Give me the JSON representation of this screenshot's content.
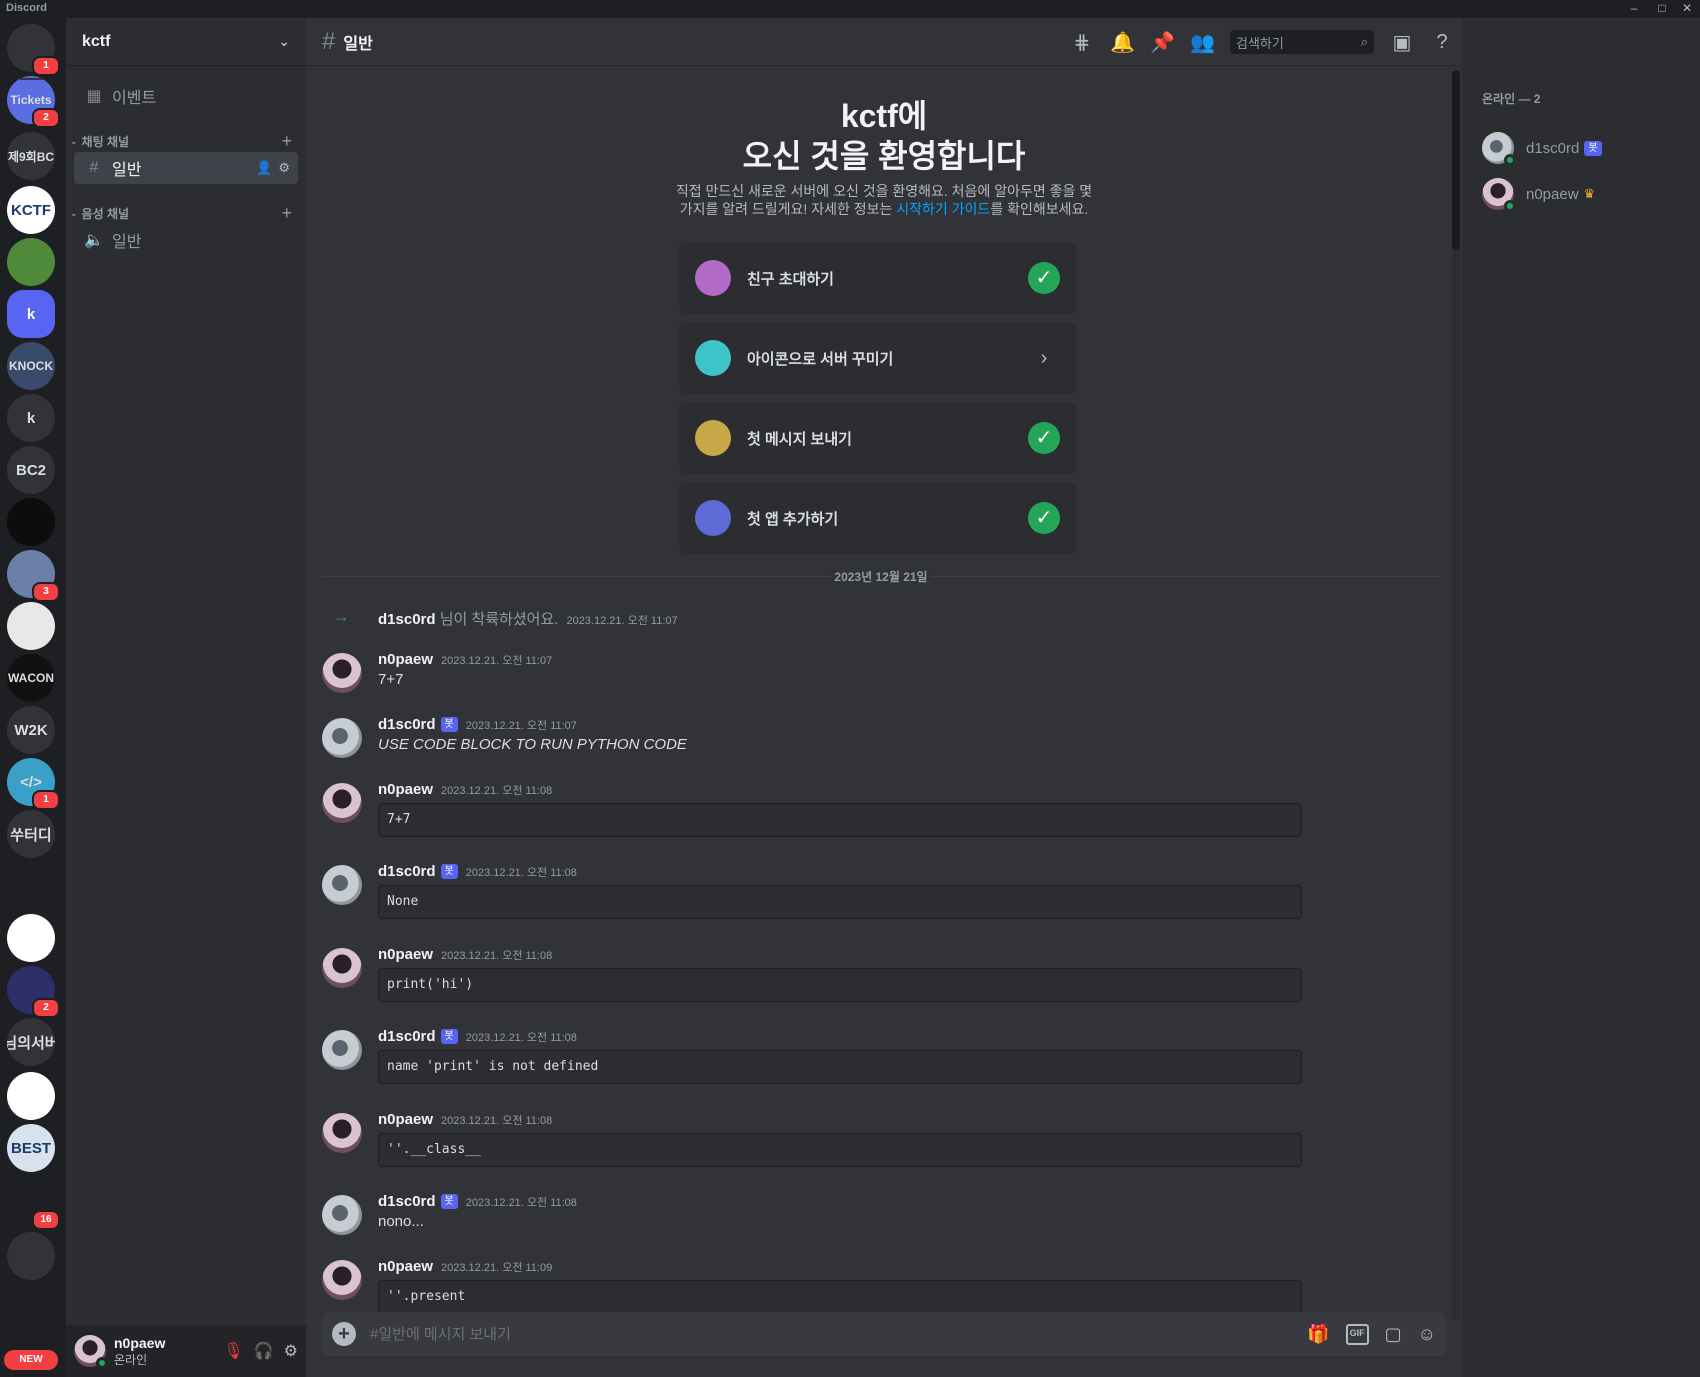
{
  "window": {
    "title": "Discord",
    "controls": [
      "–",
      "□",
      "✕"
    ]
  },
  "rail": {
    "servers": [
      {
        "label": "",
        "icon": "discord-home-icon",
        "badge": "1",
        "bg": "#313338"
      },
      {
        "label": "Tickets",
        "badge": "2",
        "bg": "#5b6ee1"
      },
      {
        "label": "제9회BC",
        "badge": "",
        "bg": "#313338"
      },
      {
        "label": "KCTF",
        "badge": "",
        "bg": "#ffffff"
      },
      {
        "label": "",
        "icon": "pepe-icon",
        "badge": "",
        "bg": "#4f8a3b"
      },
      {
        "label": "k",
        "badge": "",
        "bg": "#5865f2",
        "active": true
      },
      {
        "label": "KNOCK",
        "badge": "",
        "bg": "#3a4a6b"
      },
      {
        "label": "k",
        "badge": "",
        "bg": "#313338"
      },
      {
        "label": "BC2",
        "badge": "",
        "bg": "#313338"
      },
      {
        "label": "",
        "icon": "sword-icon",
        "badge": "",
        "bg": "#0d0d0d"
      },
      {
        "label": "",
        "icon": "emblem-icon",
        "badge": "3",
        "bg": "#6b7fa8"
      },
      {
        "label": "",
        "icon": "star-emblem-icon",
        "badge": "",
        "bg": "#e8e8e8"
      },
      {
        "label": "WACON",
        "badge": "",
        "bg": "#111111"
      },
      {
        "label": "W2K",
        "badge": "",
        "bg": "#313338"
      },
      {
        "label": "</>",
        "badge": "1",
        "bg": "#3aa0c8"
      },
      {
        "label": "쑤터디",
        "badge": "",
        "bg": "#313338"
      },
      {
        "label": "",
        "icon": "arrow-logo-icon",
        "badge": "",
        "bg": "#1e1f22"
      },
      {
        "label": "",
        "icon": "sunglasses-icon",
        "badge": "",
        "bg": "#ffffff"
      },
      {
        "label": "",
        "icon": "book-icon",
        "badge": "2",
        "bg": "#2d2f6b"
      },
      {
        "label": "님의서버",
        "badge": "",
        "bg": "#313338"
      },
      {
        "label": "",
        "icon": "rune-icon",
        "badge": "",
        "bg": "#ffffff"
      },
      {
        "label": "BEST",
        "badge": "",
        "bg": "#d7e2ee"
      },
      {
        "label": "",
        "icon": "blocks-icon",
        "badge": "16",
        "bg": "#1e1f22"
      },
      {
        "label": "",
        "icon": "folder-icon",
        "badge": "",
        "bg": "#313338"
      }
    ],
    "new_label": "NEW"
  },
  "sidebar": {
    "server_name": "kctf",
    "events_label": "이벤트",
    "text_category": "채팅 채널",
    "text_channel": "일반",
    "voice_category": "음성 채널",
    "voice_channel": "일반",
    "user": {
      "name": "n0paew",
      "status": "온라인"
    }
  },
  "header": {
    "channel": "일반",
    "search_placeholder": "검색하기"
  },
  "welcome": {
    "title_line1": "kctf에",
    "title_line2": "오신 것을 환영합니다",
    "desc_before": "직접 만드신 새로운 서버에 오신 것을 환영해요. 처음에 알아두면 좋을 몇 가지를 알려 드릴게요! 자세한 정보는 ",
    "desc_link": "시작하기 가이드",
    "desc_after": "를 확인해보세요."
  },
  "cards": [
    {
      "label": "친구 초대하기",
      "done": true,
      "icon_color": "#b26ac7"
    },
    {
      "label": "아이콘으로 서버 꾸미기",
      "done": false,
      "icon_color": "#3ec3c9"
    },
    {
      "label": "첫 메시지 보내기",
      "done": true,
      "icon_color": "#c9a84a"
    },
    {
      "label": "첫 앱 추가하기",
      "done": true,
      "icon_color": "#5c6bd6"
    }
  ],
  "date_divider": "2023년 12월 21일",
  "join": {
    "name": "d1sc0rd",
    "text": " 님이 착륙하셨어요.",
    "time": "2023.12.21. 오전 11:07"
  },
  "messages": [
    {
      "user": "n0paew",
      "bot": false,
      "time": "2023.12.21. 오전 11:07",
      "text": "7+7",
      "code": false
    },
    {
      "user": "d1sc0rd",
      "bot": true,
      "time": "2023.12.21. 오전 11:07",
      "text": "USE CODE BLOCK TO RUN PYTHON CODE",
      "code": false,
      "italic": true
    },
    {
      "user": "n0paew",
      "bot": false,
      "time": "2023.12.21. 오전 11:08",
      "text": "7+7",
      "code": true
    },
    {
      "user": "d1sc0rd",
      "bot": true,
      "time": "2023.12.21. 오전 11:08",
      "text": "None",
      "code": true
    },
    {
      "user": "n0paew",
      "bot": false,
      "time": "2023.12.21. 오전 11:08",
      "text": "print('hi')",
      "code": true
    },
    {
      "user": "d1sc0rd",
      "bot": true,
      "time": "2023.12.21. 오전 11:08",
      "text": "name 'print' is not defined",
      "code": true
    },
    {
      "user": "n0paew",
      "bot": false,
      "time": "2023.12.21. 오전 11:08",
      "text": "''.__class__",
      "code": true
    },
    {
      "user": "d1sc0rd",
      "bot": true,
      "time": "2023.12.21. 오전 11:08",
      "text": "nono...",
      "code": false
    },
    {
      "user": "n0paew",
      "bot": false,
      "time": "2023.12.21. 오전 11:09",
      "text": "''.present",
      "code": true
    }
  ],
  "bot_tag": "봇",
  "composer": {
    "placeholder": "#일반에 메시지 보내기",
    "gif_label": "GIF"
  },
  "members": {
    "header": "온라인 — 2",
    "list": [
      {
        "name": "d1sc0rd",
        "bot": true,
        "owner": false
      },
      {
        "name": "n0paew",
        "bot": false,
        "owner": true
      }
    ]
  }
}
